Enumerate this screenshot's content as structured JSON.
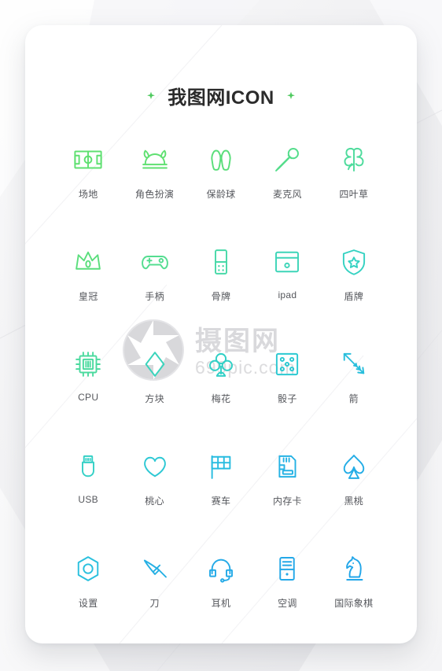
{
  "header": {
    "title": "我图网ICON",
    "spark_left": "sparkle-icon",
    "spark_right": "sparkle-icon"
  },
  "watermark": {
    "brand": "摄图网",
    "site": "699pic.com",
    "logo": "aperture-icon"
  },
  "palette": {
    "green": "#5FE071",
    "green2": "#56DC86",
    "teal": "#3BD4B4",
    "teal2": "#2FCCC8",
    "cyan": "#27B8DC",
    "blue": "#24A9E6",
    "label": "#55575C",
    "title": "#2B2B2B",
    "card": "#FFFFFF",
    "background": "#F2F2F4"
  },
  "grid": {
    "columns": 5,
    "rows": 5,
    "icons": [
      {
        "label": "场地",
        "icon": "soccer-field-icon",
        "color": "#5FE071"
      },
      {
        "label": "角色扮演",
        "icon": "viking-helmet-icon",
        "color": "#5FE071"
      },
      {
        "label": "保龄球",
        "icon": "bowling-pins-icon",
        "color": "#5ADE7A"
      },
      {
        "label": "麦克风",
        "icon": "microphone-icon",
        "color": "#55DD8C"
      },
      {
        "label": "四叶草",
        "icon": "clover-icon",
        "color": "#4EDB9C"
      },
      {
        "label": "皇冠",
        "icon": "crown-icon",
        "color": "#5ADE7C"
      },
      {
        "label": "手柄",
        "icon": "gamepad-icon",
        "color": "#54DD90"
      },
      {
        "label": "骨牌",
        "icon": "domino-icon",
        "color": "#48D9A8"
      },
      {
        "label": "ipad",
        "icon": "tablet-icon",
        "color": "#3DD5B8"
      },
      {
        "label": "盾牌",
        "icon": "shield-star-icon",
        "color": "#35D2C2"
      },
      {
        "label": "CPU",
        "icon": "cpu-chip-icon",
        "color": "#4BDA9E"
      },
      {
        "label": "方块",
        "icon": "diamond-suit-icon",
        "color": "#3AD4BC"
      },
      {
        "label": "梅花",
        "icon": "club-suit-icon",
        "color": "#31D0C6"
      },
      {
        "label": "骰子",
        "icon": "dice-icon",
        "color": "#2BC9D2"
      },
      {
        "label": "箭",
        "icon": "arrow-icon",
        "color": "#28BEDC"
      },
      {
        "label": "USB",
        "icon": "usb-icon",
        "color": "#34D0C6"
      },
      {
        "label": "桃心",
        "icon": "heart-suit-icon",
        "color": "#2DC8D4"
      },
      {
        "label": "赛车",
        "icon": "checkered-flag-icon",
        "color": "#28BCE0"
      },
      {
        "label": "内存卡",
        "icon": "memory-card-icon",
        "color": "#26B2E4"
      },
      {
        "label": "黑桃",
        "icon": "spade-suit-icon",
        "color": "#24ADE6"
      },
      {
        "label": "设置",
        "icon": "hex-settings-icon",
        "color": "#2AC0DE"
      },
      {
        "label": "刀",
        "icon": "knife-icon",
        "color": "#26B0E4"
      },
      {
        "label": "耳机",
        "icon": "headset-icon",
        "color": "#24AAE7"
      },
      {
        "label": "空调",
        "icon": "tower-pc-icon",
        "color": "#23A8E8"
      },
      {
        "label": "国际象棋",
        "icon": "chess-knight-icon",
        "color": "#22A6E9"
      }
    ]
  }
}
